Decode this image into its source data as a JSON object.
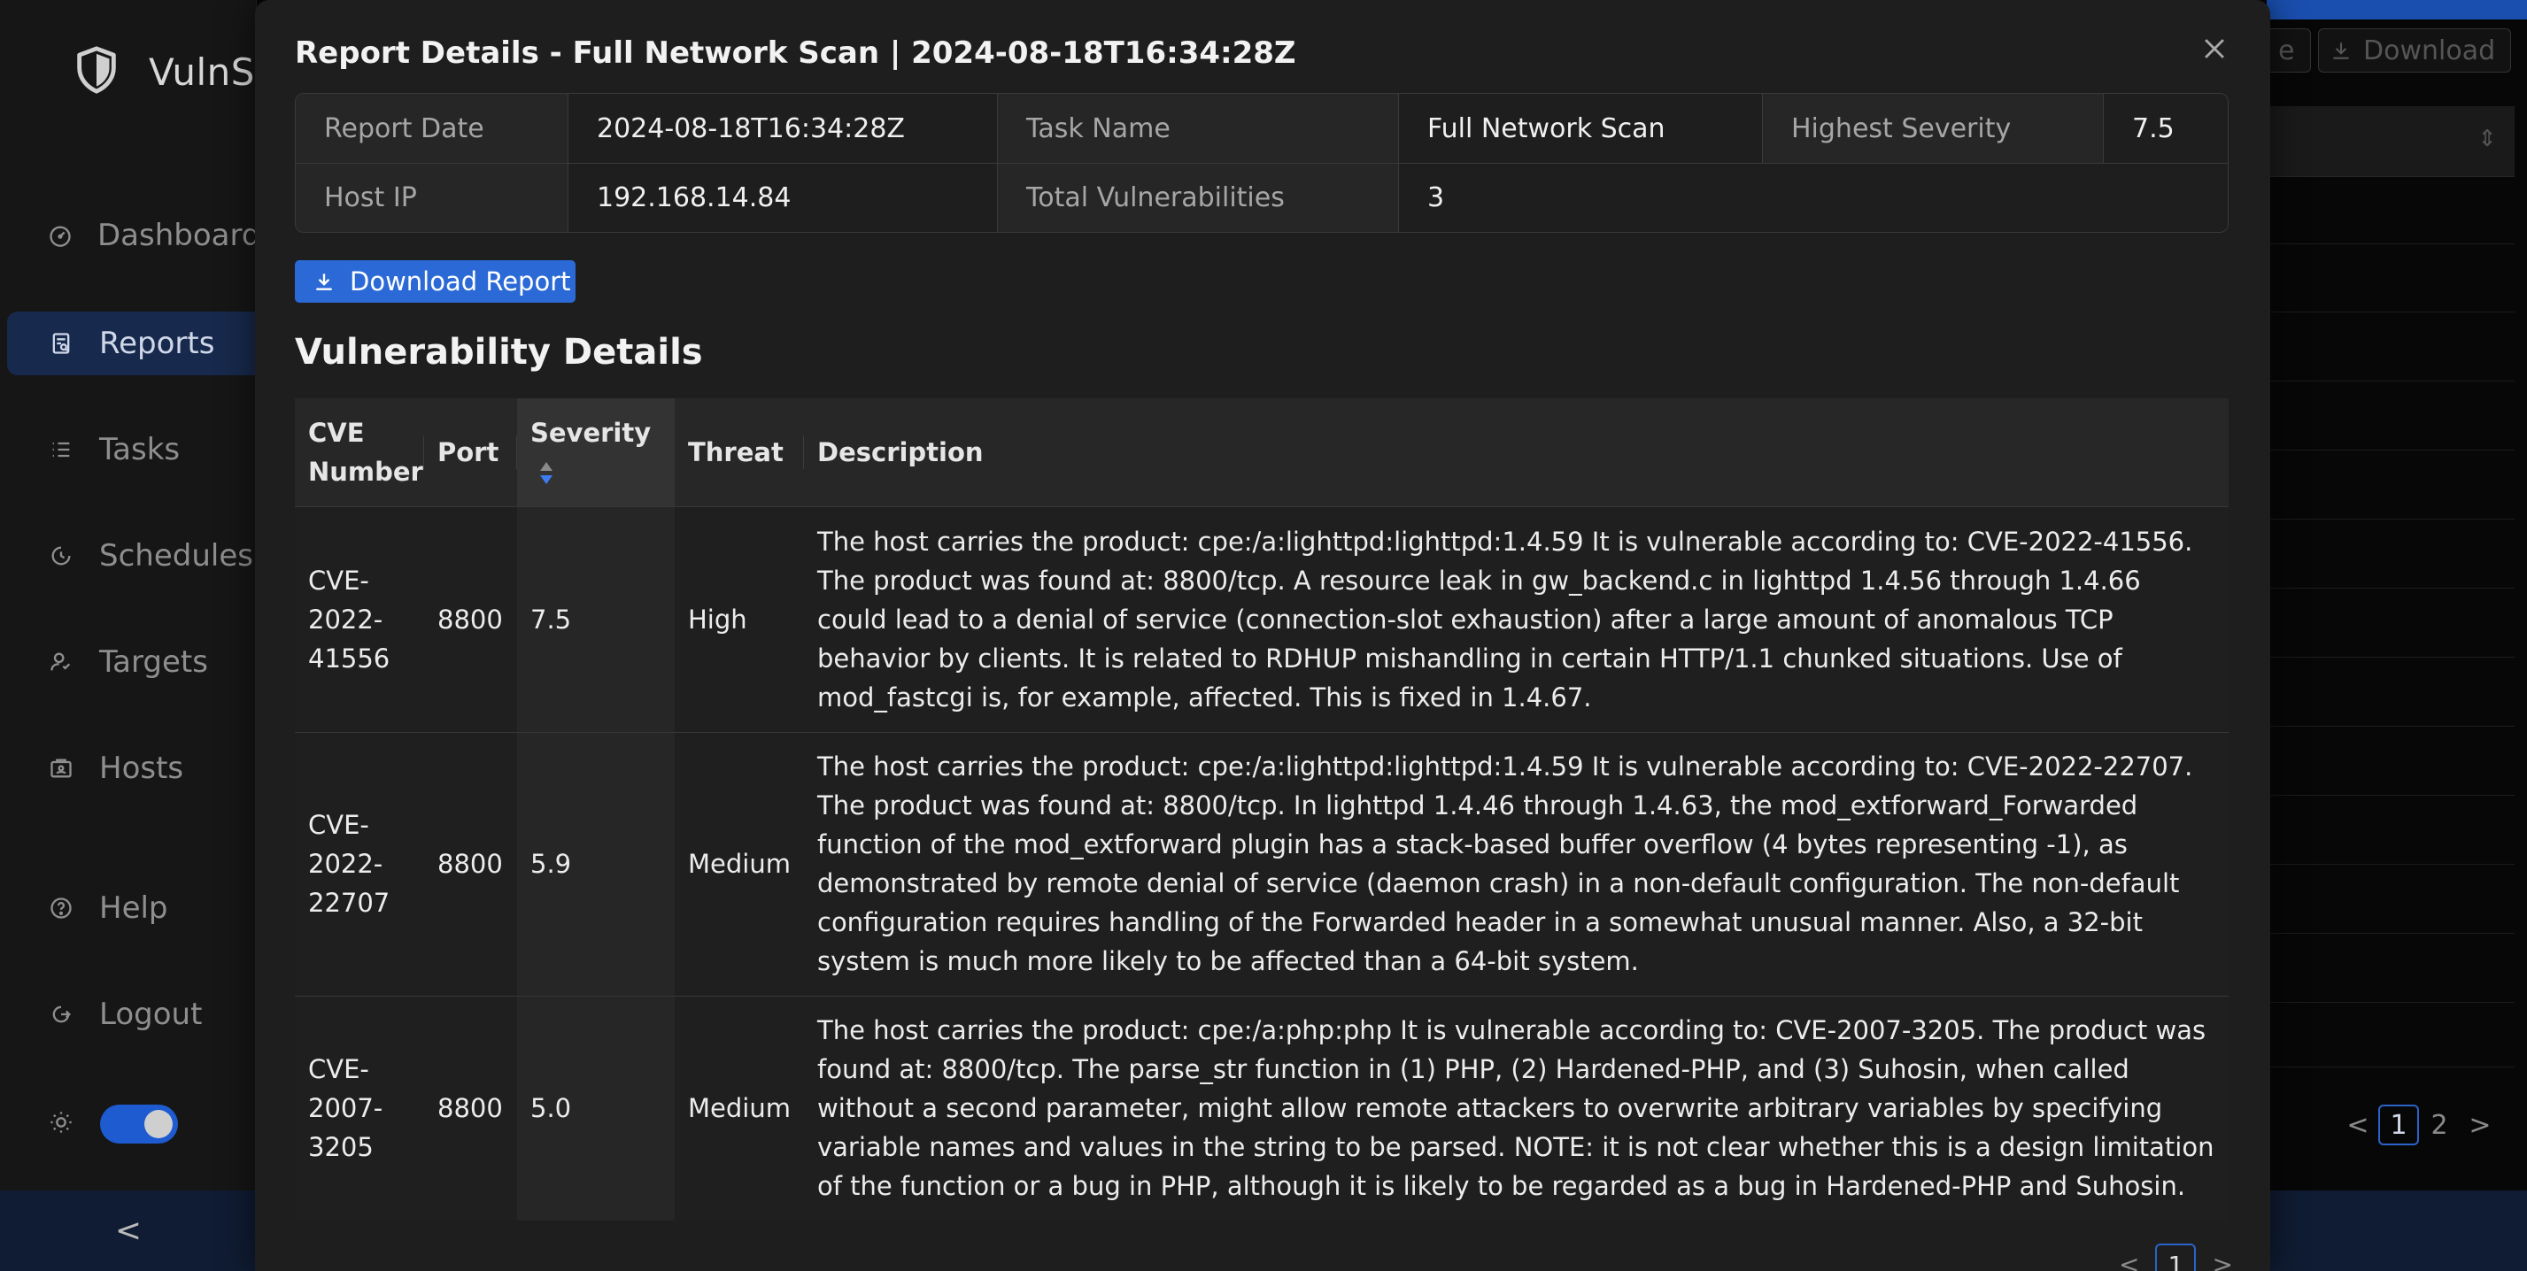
{
  "app": {
    "brand_name": "VulnSc"
  },
  "sidebar": {
    "items": [
      {
        "label": "Dashboard",
        "icon": "dashboard-icon",
        "active": false
      },
      {
        "label": "Reports",
        "icon": "reports-icon",
        "active": true
      },
      {
        "label": "Tasks",
        "icon": "tasks-icon",
        "active": false
      },
      {
        "label": "Schedules",
        "icon": "schedules-icon",
        "active": false
      },
      {
        "label": "Targets",
        "icon": "targets-icon",
        "active": false
      },
      {
        "label": "Hosts",
        "icon": "hosts-icon",
        "active": false
      },
      {
        "label": "Help",
        "icon": "help-icon",
        "active": false
      },
      {
        "label": "Logout",
        "icon": "logout-icon",
        "active": false
      }
    ],
    "theme_toggle_on": true,
    "collapse_glyph": "<"
  },
  "background": {
    "partial_button_label": "e",
    "download_label": "Download",
    "pager": {
      "prev": "<",
      "pages": [
        "1",
        "2"
      ],
      "current": "1",
      "next": ">"
    }
  },
  "modal": {
    "title": "Report Details - Full Network Scan | 2024-08-18T16:34:28Z",
    "info": {
      "report_date_label": "Report Date",
      "report_date": "2024-08-18T16:34:28Z",
      "task_name_label": "Task Name",
      "task_name": "Full Network Scan",
      "highest_severity_label": "Highest Severity",
      "highest_severity": "7.5",
      "host_ip_label": "Host IP",
      "host_ip": "192.168.14.84",
      "total_vulns_label": "Total Vulnerabilities",
      "total_vulns": "3"
    },
    "download_button_label": "Download Report",
    "section_title": "Vulnerability Details",
    "table": {
      "headers": {
        "cve": "CVE Number",
        "port": "Port",
        "severity": "Severity",
        "threat": "Threat",
        "description": "Description"
      },
      "rows": [
        {
          "cve": "CVE-2022-41556",
          "port": "8800",
          "severity": "7.5",
          "threat": "High",
          "description": "The host carries the product: cpe:/a:lighttpd:lighttpd:1.4.59 It is vulnerable according to: CVE-2022-41556. The product was found at: 8800/tcp. A resource leak in gw_backend.c in lighttpd 1.4.56 through 1.4.66 could lead to a denial of service (connection-slot exhaustion) after a large amount of anomalous TCP behavior by clients. It is related to RDHUP mishandling in certain HTTP/1.1 chunked situations. Use of mod_fastcgi is, for example, affected. This is fixed in 1.4.67."
        },
        {
          "cve": "CVE-2022-22707",
          "port": "8800",
          "severity": "5.9",
          "threat": "Medium",
          "description": "The host carries the product: cpe:/a:lighttpd:lighttpd:1.4.59 It is vulnerable according to: CVE-2022-22707. The product was found at: 8800/tcp. In lighttpd 1.4.46 through 1.4.63, the mod_extforward_Forwarded function of the mod_extforward plugin has a stack-based buffer overflow (4 bytes representing -1), as demonstrated by remote denial of service (daemon crash) in a non-default configuration. The non-default configuration requires handling of the Forwarded header in a somewhat unusual manner. Also, a 32-bit system is much more likely to be affected than a 64-bit system."
        },
        {
          "cve": "CVE-2007-3205",
          "port": "8800",
          "severity": "5.0",
          "threat": "Medium",
          "description": "The host carries the product: cpe:/a:php:php It is vulnerable according to: CVE-2007-3205. The product was found at: 8800/tcp. The parse_str function in (1) PHP, (2) Hardened-PHP, and (3) Suhosin, when called without a second parameter, might allow remote attackers to overwrite arbitrary variables by specifying variable names and values in the string to be parsed. NOTE: it is not clear whether this is a design limitation of the function or a bug in PHP, although it is likely to be regarded as a bug in Hardened-PHP and Suhosin."
        }
      ]
    },
    "pager": {
      "prev": "<",
      "current": "1",
      "next": ">"
    }
  },
  "colors": {
    "accent": "#2b6ad6",
    "active_nav_bg": "#172a4d",
    "modal_bg": "#1e1e1e"
  }
}
